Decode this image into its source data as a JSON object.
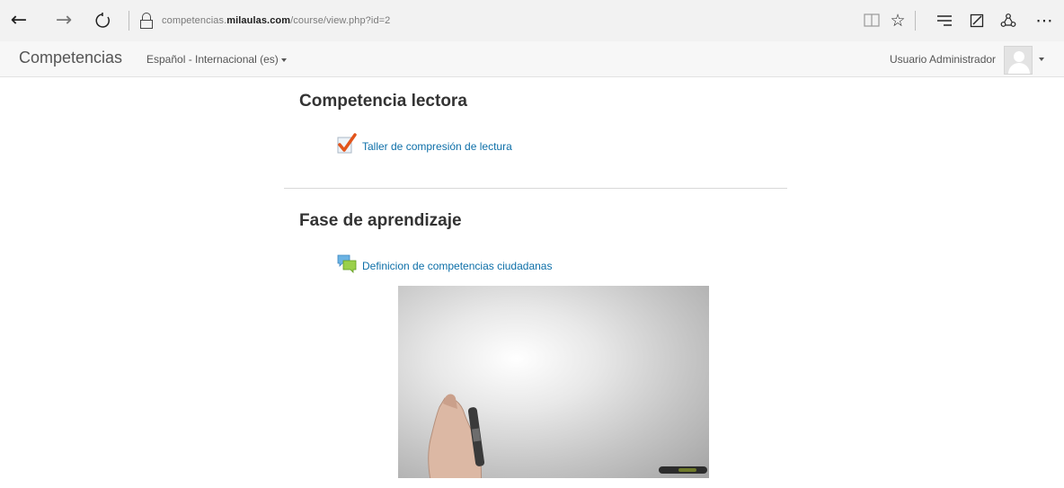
{
  "browser": {
    "back_icon": "back-arrow-icon",
    "forward_icon": "forward-arrow-icon",
    "refresh_icon": "refresh-icon",
    "url_prefix": "competencias.",
    "url_domain": "milaulas.com",
    "url_path": "/course/view.php?id=2",
    "right_icons": [
      "reading-view-icon",
      "star-icon",
      "hub-icon",
      "web-note-icon",
      "share-icon",
      "more-icon"
    ]
  },
  "navbar": {
    "brand": "Competencias",
    "language": "Español - Internacional (es)",
    "user_name": "Usuario Administrador"
  },
  "sections": [
    {
      "title": "Competencia lectora",
      "activities": [
        {
          "label": "Taller de compresión de lectura",
          "icon": "quiz-icon"
        }
      ]
    },
    {
      "title": "Fase de aprendizaje",
      "activities": [
        {
          "label": "Definicion de competencias ciudadanas",
          "icon": "forum-icon"
        }
      ]
    }
  ],
  "colors": {
    "link": "#0d6fa8",
    "navbar_bg": "#f7f7f7",
    "browser_bg": "#f2f2f2"
  }
}
